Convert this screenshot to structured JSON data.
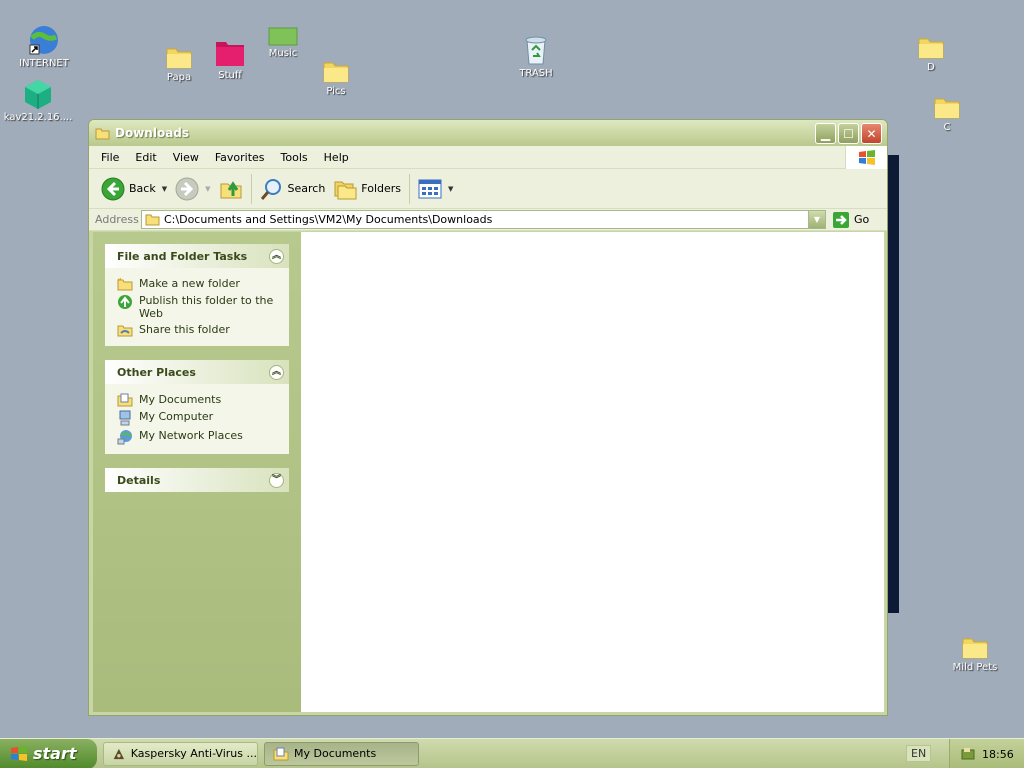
{
  "desktop": {
    "icons": [
      {
        "label": "INTERNET",
        "icon": "globe-icon"
      },
      {
        "label": "kav21.2.16....",
        "icon": "green-box-icon"
      },
      {
        "label": "Papa",
        "icon": "folder-icon"
      },
      {
        "label": "Stuff",
        "icon": "pink-folder-icon"
      },
      {
        "label": "Music",
        "icon": "green-folder-icon"
      },
      {
        "label": "Pics",
        "icon": "folder-icon"
      },
      {
        "label": "TRASH",
        "icon": "recycle-bin-icon"
      },
      {
        "label": "D",
        "icon": "folder-icon"
      },
      {
        "label": "C",
        "icon": "folder-icon"
      },
      {
        "label": "Mild Pets",
        "icon": "folder-icon"
      }
    ]
  },
  "window": {
    "title": "Downloads",
    "menu": [
      "File",
      "Edit",
      "View",
      "Favorites",
      "Tools",
      "Help"
    ],
    "toolbar": {
      "back": "Back",
      "search": "Search",
      "folders": "Folders"
    },
    "address": {
      "label": "Address",
      "value": "C:\\Documents and Settings\\VM2\\My Documents\\Downloads",
      "go": "Go"
    },
    "taskpane": {
      "file_tasks": {
        "title": "File and Folder Tasks",
        "items": [
          "Make a new folder",
          "Publish this folder to the Web",
          "Share this folder"
        ]
      },
      "other_places": {
        "title": "Other Places",
        "items": [
          "My Documents",
          "My Computer",
          "My Network Places"
        ]
      },
      "details": {
        "title": "Details"
      }
    }
  },
  "taskbar": {
    "start": "start",
    "tasks": [
      "Kaspersky Anti-Virus ...",
      "My Documents"
    ],
    "lang": "EN",
    "clock": "18:56"
  },
  "colors": {
    "desktop": "#a1acbb",
    "window_chrome": "#c8d5a4",
    "start_green": "#4f8a2a"
  }
}
